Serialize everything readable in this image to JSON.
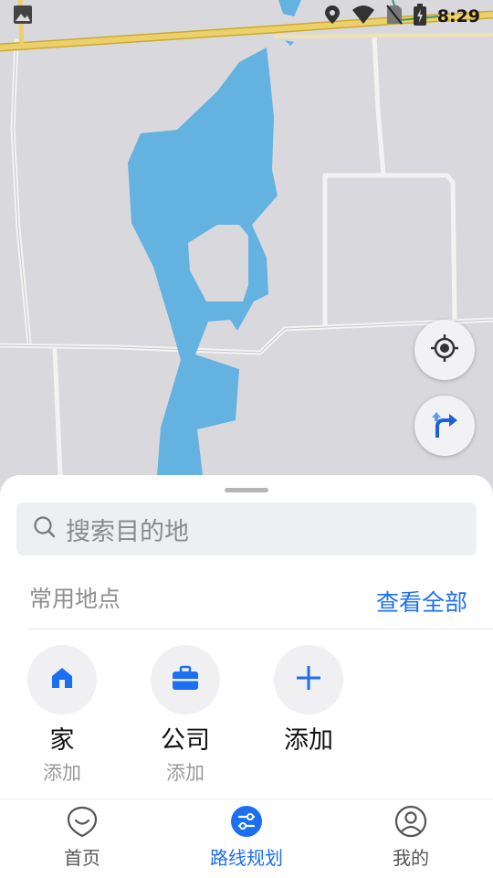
{
  "status_bar": {
    "time": "8:29",
    "icons": [
      "gallery-icon",
      "location-icon",
      "wifi-icon",
      "no-sim-icon",
      "battery-charging-icon"
    ]
  },
  "map": {
    "water_color": "#64b2e0",
    "land_color": "#d9d9dd",
    "road_color": "#f0f0f0",
    "highway_color": "#e7c24a"
  },
  "map_controls": {
    "locate_icon": "crosshair-icon",
    "route_icon": "turn-arrow-icon"
  },
  "bottom_sheet": {
    "search": {
      "placeholder": "搜索目的地"
    },
    "frequent_places": {
      "title": "常用地点",
      "view_all": "查看全部",
      "items": [
        {
          "name": "家",
          "sub": "添加",
          "icon": "home-icon"
        },
        {
          "name": "公司",
          "sub": "添加",
          "icon": "briefcase-icon"
        },
        {
          "name": "添加",
          "sub": "",
          "icon": "plus-icon"
        }
      ]
    }
  },
  "tab_bar": {
    "tabs": [
      {
        "label": "首页",
        "icon": "home-tab-icon",
        "active": false
      },
      {
        "label": "路线规划",
        "icon": "route-plan-icon",
        "active": true
      },
      {
        "label": "我的",
        "icon": "profile-icon",
        "active": false
      }
    ]
  },
  "colors": {
    "accent": "#1d6ff2"
  }
}
